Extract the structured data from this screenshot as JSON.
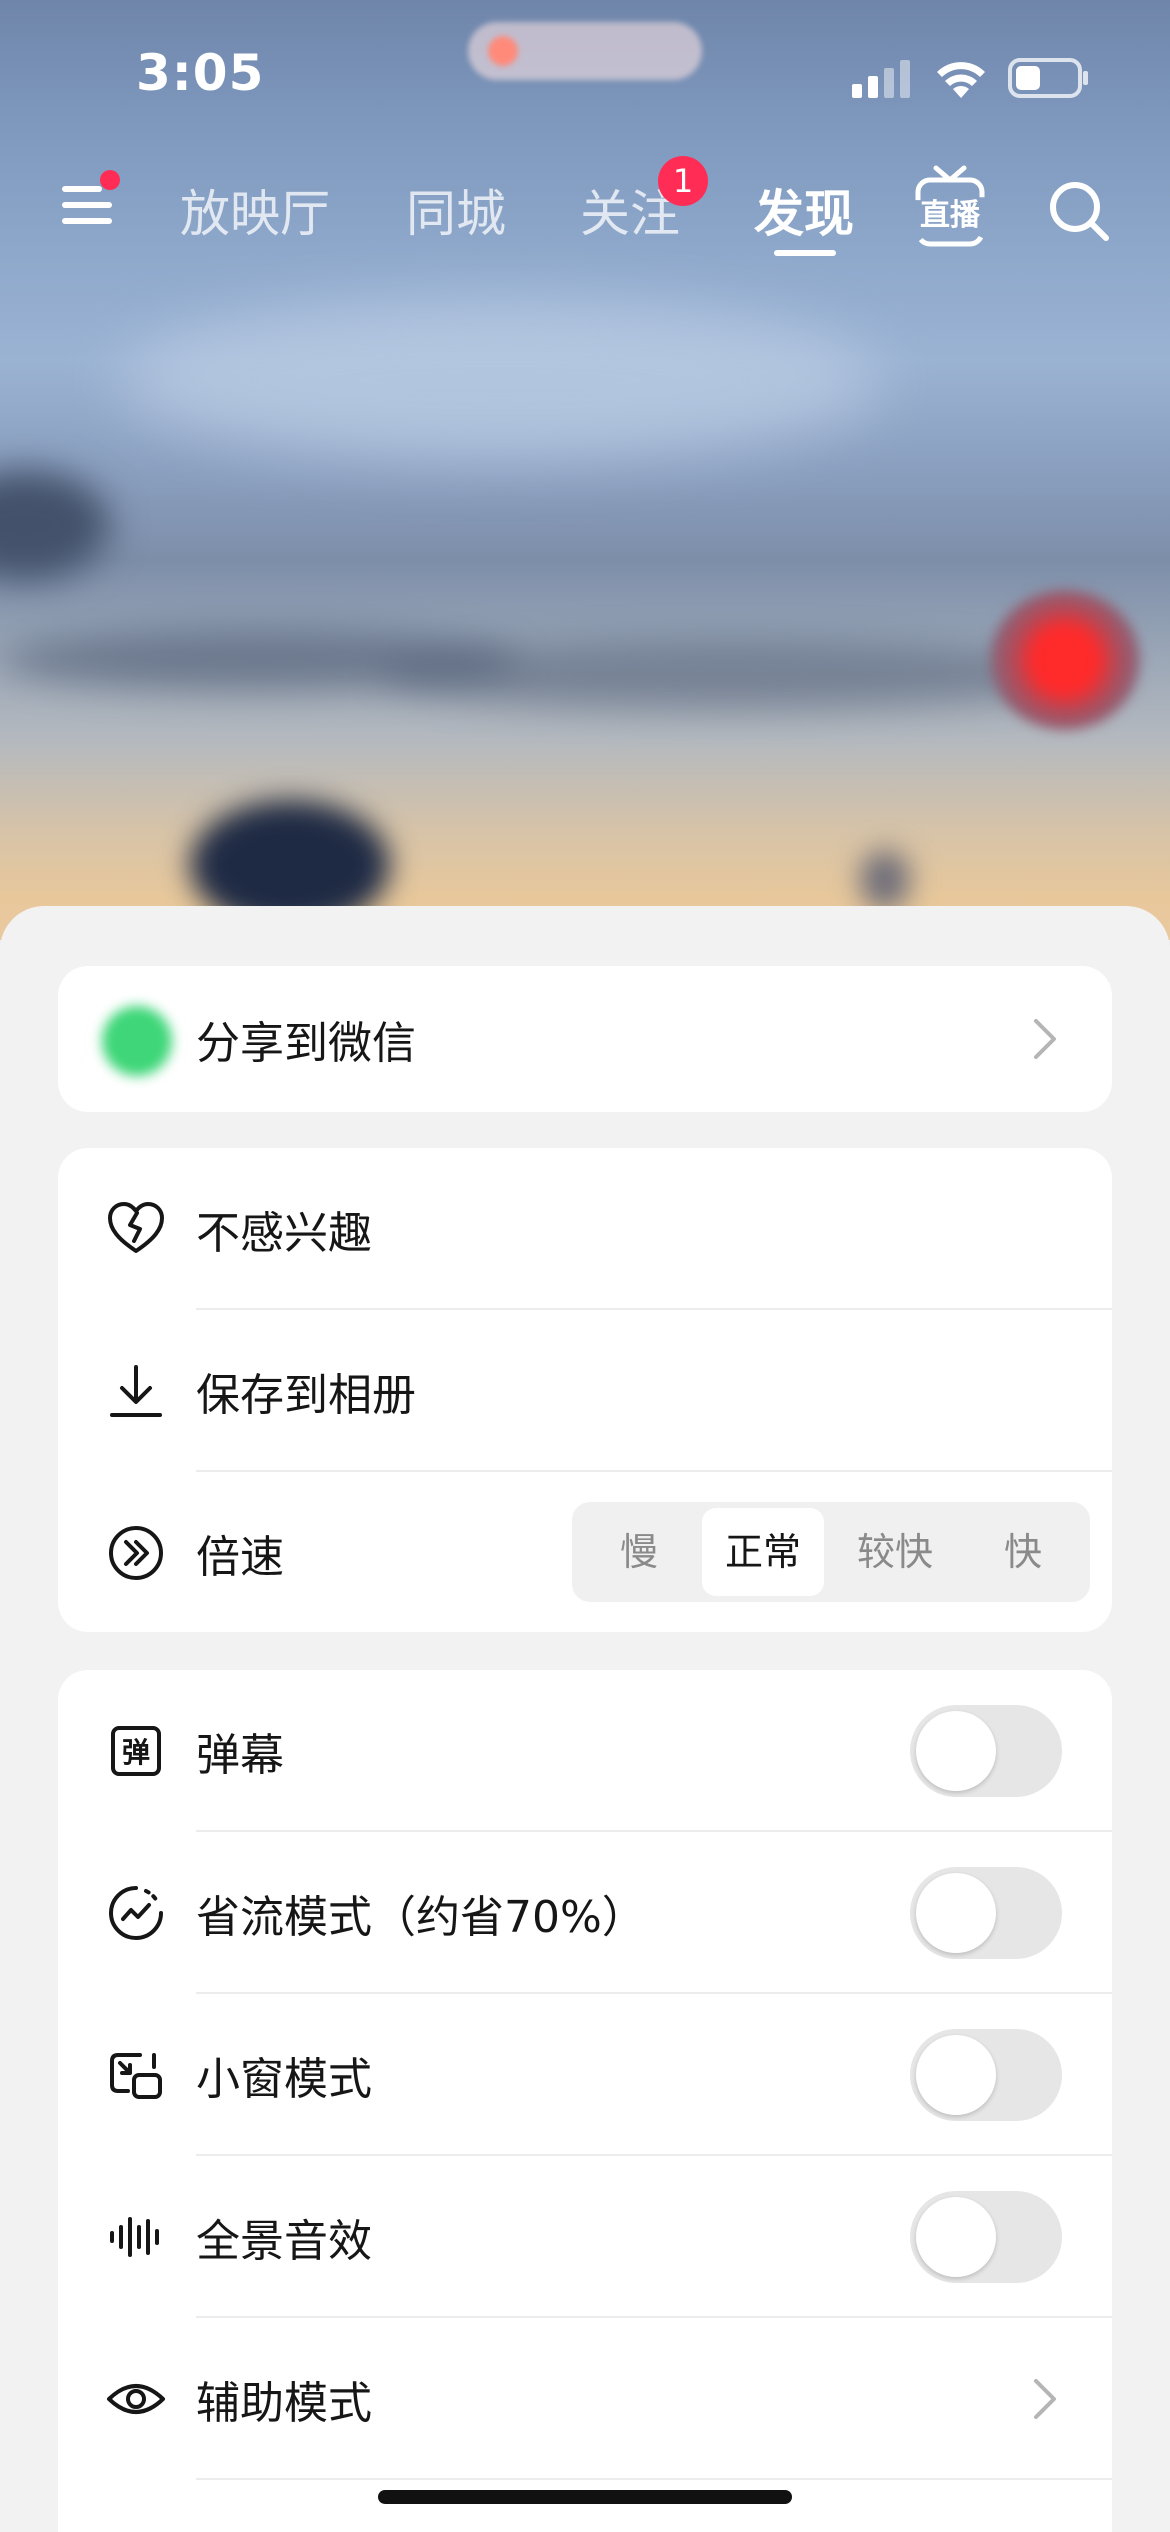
{
  "status_bar": {
    "time": "3:05",
    "icons": [
      "signal-icon",
      "wifi-icon",
      "battery-icon"
    ]
  },
  "top_nav": {
    "tabs": [
      {
        "label": "放映厅",
        "active": false
      },
      {
        "label": "同城",
        "active": false
      },
      {
        "label": "关注",
        "active": false,
        "badge": "1"
      },
      {
        "label": "发现",
        "active": true
      }
    ],
    "live_label": "直播",
    "menu_has_dot": true
  },
  "sheet": {
    "share": {
      "label": "分享到微信"
    },
    "actions": [
      {
        "icon": "broken-heart-icon",
        "label": "不感兴趣"
      },
      {
        "icon": "download-icon",
        "label": "保存到相册"
      },
      {
        "icon": "fast-forward-icon",
        "label": "倍速"
      }
    ],
    "speed": {
      "options": [
        "慢",
        "正常",
        "较快",
        "快"
      ],
      "selected": "正常"
    },
    "settings": [
      {
        "icon": "danmaku-icon",
        "label": "弹幕",
        "control": "toggle",
        "on": false
      },
      {
        "icon": "data-saver-icon",
        "label": "省流模式（约省70%）",
        "control": "toggle",
        "on": false
      },
      {
        "icon": "picture-in-picture-icon",
        "label": "小窗模式",
        "control": "toggle",
        "on": false
      },
      {
        "icon": "audio-wave-icon",
        "label": "全景音效",
        "control": "toggle",
        "on": false
      },
      {
        "icon": "eye-icon",
        "label": "辅助模式",
        "control": "chevron"
      }
    ]
  },
  "colors": {
    "accent_badge": "#ff2d55",
    "sheet_bg": "#f2f2f2",
    "card_bg": "#ffffff",
    "toggle_off": "#e6e6e6"
  }
}
